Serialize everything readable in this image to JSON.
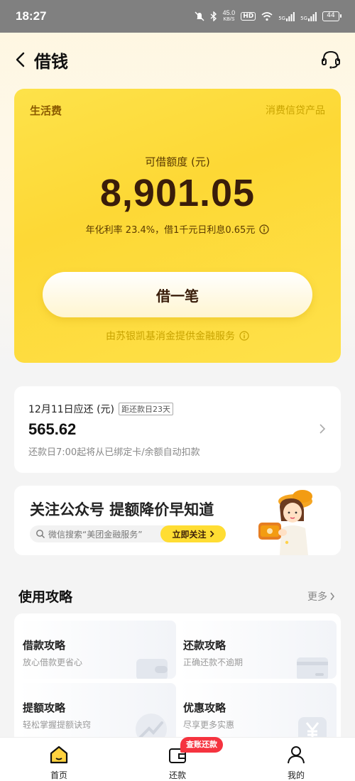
{
  "status_bar": {
    "time": "18:27",
    "speed_value": "45.0",
    "speed_unit": "KB/S",
    "hd": "HD",
    "signal_label_1": "5G",
    "signal_label_2": "5G",
    "battery": "44"
  },
  "nav": {
    "title": "借钱"
  },
  "loan_card": {
    "tag": "生活费",
    "product": "消费信贷产品",
    "limit_label": "可借额度 (元)",
    "amount": "8,901.05",
    "rate_text": "年化利率  23.4%，借1千元日利息0.65元",
    "borrow_button": "借一笔",
    "provider": "由苏银凯基消金提供金融服务"
  },
  "repayment": {
    "due_date": "12月11日应还 (元)",
    "days_left": "距还款日23天",
    "amount": "565.62",
    "note": "还款日7:00起将从已绑定卡/余额自动扣款"
  },
  "promo": {
    "title": "关注公众号 提额降价早知道",
    "search_text": "微信搜索“美团金融服务”",
    "follow_button": "立即关注"
  },
  "guides": {
    "title": "使用攻略",
    "more": "更多",
    "items": [
      {
        "title": "借款攻略",
        "subtitle": "放心借款更省心"
      },
      {
        "title": "还款攻略",
        "subtitle": "正确还款不逾期"
      },
      {
        "title": "提额攻略",
        "subtitle": "轻松掌握提额诀窍"
      },
      {
        "title": "优惠攻略",
        "subtitle": "尽享更多实惠"
      }
    ]
  },
  "tabbar": {
    "badge": "查账还款",
    "tabs": [
      {
        "label": "首页",
        "icon": "home-icon",
        "active": true
      },
      {
        "label": "还款",
        "icon": "wallet-icon",
        "active": false
      },
      {
        "label": "我的",
        "icon": "user-icon",
        "active": false
      }
    ]
  },
  "colors": {
    "card_yellow": "#fdd835",
    "accent_brown": "#3a1d0a",
    "badge_red": "#f5333f"
  }
}
